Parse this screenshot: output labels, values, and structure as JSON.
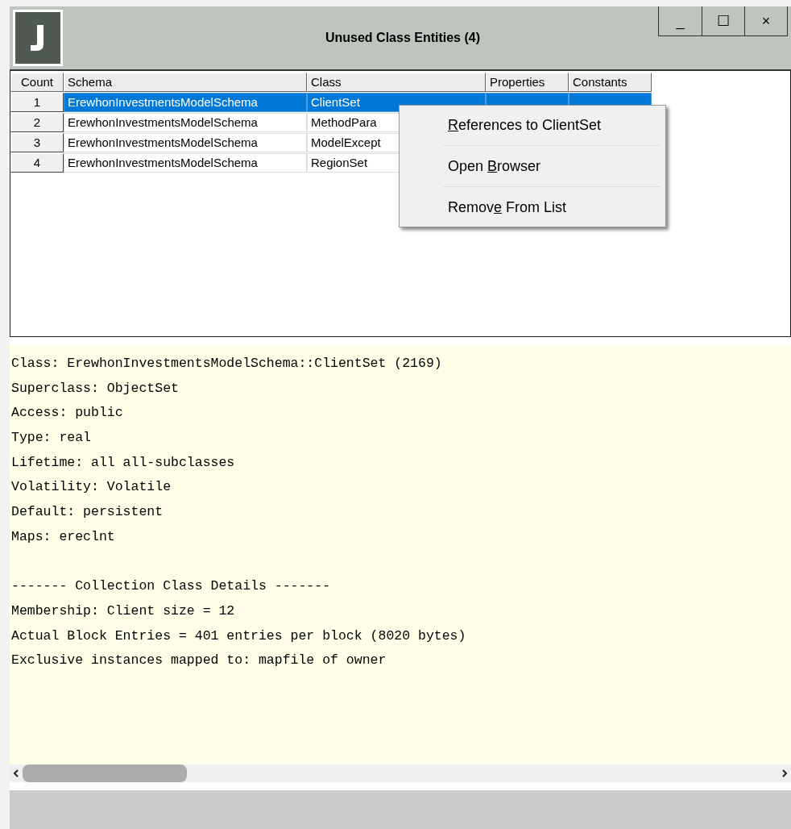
{
  "window": {
    "title": "Unused Class Entities (4)",
    "controls": [
      "_",
      "☐",
      "×"
    ]
  },
  "table": {
    "columns": [
      "Count",
      "Schema",
      "Class",
      "Properties",
      "Constants"
    ],
    "rows": [
      {
        "count": "1",
        "schema": "ErewhonInvestmentsModelSchema",
        "class": "ClientSet",
        "selected": true
      },
      {
        "count": "2",
        "schema": "ErewhonInvestmentsModelSchema",
        "class": "MethodPara",
        "selected": false
      },
      {
        "count": "3",
        "schema": "ErewhonInvestmentsModelSchema",
        "class": "ModelExcept",
        "selected": false
      },
      {
        "count": "4",
        "schema": "ErewhonInvestmentsModelSchema",
        "class": "RegionSet",
        "selected": false
      }
    ]
  },
  "context_menu": {
    "items": [
      {
        "key": "R",
        "after": "eferences to ClientSet"
      },
      {
        "before": "Open ",
        "key": "B",
        "after": "rowser"
      },
      {
        "before": "Remov",
        "key": "e",
        "after": " From List"
      }
    ]
  },
  "details": {
    "groups": [
      [
        "Class: ErewhonInvestmentsModelSchema::ClientSet (2169)",
        "Superclass: ObjectSet",
        "Access: public",
        "Type: real",
        "Lifetime: all all-subclasses",
        "Volatility: Volatile",
        "Default: persistent",
        "Maps: ereclnt"
      ],
      [
        "------- Collection Class Details -------",
        "Membership: Client size = 12",
        "Actual Block Entries = 401 entries per block (8020 bytes)",
        "Exclusive instances mapped to: mapfile of owner"
      ]
    ]
  }
}
